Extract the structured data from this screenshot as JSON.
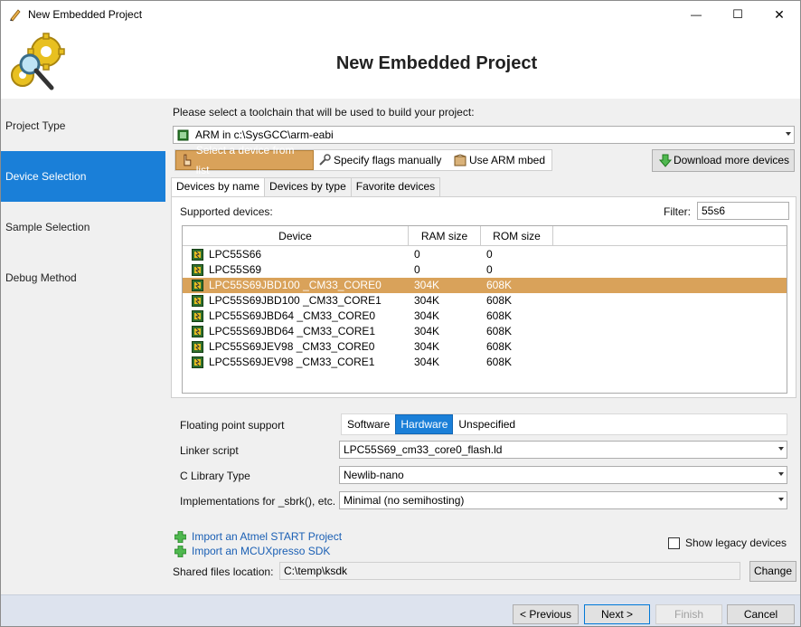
{
  "window": {
    "title": "New Embedded Project",
    "minimize_glyph": "—",
    "maximize_glyph": "☐",
    "close_glyph": "✕"
  },
  "header": {
    "title": "New Embedded Project"
  },
  "sidebar": {
    "items": [
      {
        "label": "Project Type"
      },
      {
        "label": "Device Selection"
      },
      {
        "label": "Sample Selection"
      },
      {
        "label": "Debug Method"
      }
    ],
    "active": "Device Selection"
  },
  "toolchain": {
    "prompt": "Please select a toolchain that will be used to build your project:",
    "selected": "ARM in c:\\SysGCC\\arm-eabi"
  },
  "mode": {
    "options": [
      {
        "label": "Select a device from list",
        "icon": "finger-pointer-icon"
      },
      {
        "label": "Specify flags manually",
        "icon": "wrench-icon"
      },
      {
        "label": "Use ARM mbed",
        "icon": "mbed-box-icon"
      }
    ],
    "selected_index": 0
  },
  "download_button": {
    "label": "Download more devices",
    "icon": "download-arrow-icon"
  },
  "tabs": [
    {
      "label": "Devices by name"
    },
    {
      "label": "Devices by type"
    },
    {
      "label": "Favorite devices"
    }
  ],
  "devices": {
    "supported_label": "Supported devices:",
    "filter_label": "Filter:",
    "filter_value": "55s6",
    "columns": [
      "Device",
      "RAM size",
      "ROM size"
    ],
    "rows": [
      {
        "device": "LPC55S66",
        "ram": "0",
        "rom": "0"
      },
      {
        "device": "LPC55S69",
        "ram": "0",
        "rom": "0"
      },
      {
        "device": "LPC55S69JBD100 _CM33_CORE0",
        "ram": "304K",
        "rom": "608K"
      },
      {
        "device": "LPC55S69JBD100 _CM33_CORE1",
        "ram": "304K",
        "rom": "608K"
      },
      {
        "device": "LPC55S69JBD64 _CM33_CORE0",
        "ram": "304K",
        "rom": "608K"
      },
      {
        "device": "LPC55S69JBD64 _CM33_CORE1",
        "ram": "304K",
        "rom": "608K"
      },
      {
        "device": "LPC55S69JEV98 _CM33_CORE0",
        "ram": "304K",
        "rom": "608K"
      },
      {
        "device": "LPC55S69JEV98 _CM33_CORE1",
        "ram": "304K",
        "rom": "608K"
      }
    ],
    "selected_row": 2
  },
  "settings": {
    "fp_label": "Floating point support",
    "fp_options": [
      "Software",
      "Hardware",
      "Unspecified"
    ],
    "fp_selected": "Hardware",
    "linker_label": "Linker script",
    "linker_value": "LPC55S69_cm33_core0_flash.ld",
    "clib_label": "C Library Type",
    "clib_value": "Newlib-nano",
    "sbrk_label": "Implementations for _sbrk(), etc.",
    "sbrk_value": "Minimal (no semihosting)"
  },
  "links": {
    "atmel": "Import an Atmel START Project",
    "mcux": "Import an MCUXpresso SDK"
  },
  "legacy": {
    "label": "Show legacy devices",
    "checked": false
  },
  "shared": {
    "label": "Shared files location:",
    "value": "C:\\temp\\ksdk",
    "button": "Change"
  },
  "footer": {
    "previous": "< Previous",
    "next": "Next >",
    "finish": "Finish",
    "cancel": "Cancel"
  },
  "colors": {
    "accent": "#1a7fd8",
    "selection": "#d9a25a",
    "link": "#1a5fb4"
  }
}
